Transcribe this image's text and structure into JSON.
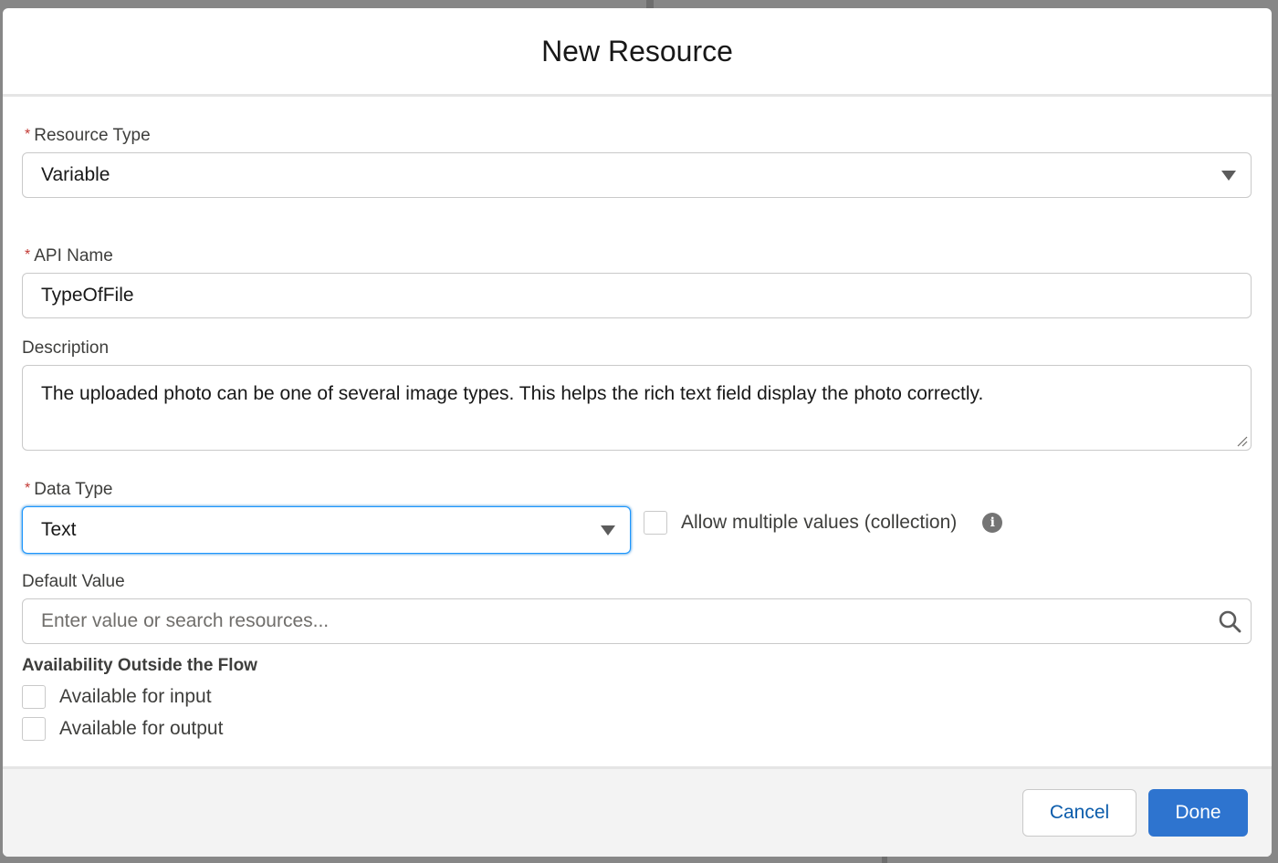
{
  "dialog": {
    "title": "New Resource"
  },
  "fields": {
    "resource_type": {
      "label": "Resource Type",
      "required": "*",
      "value": "Variable"
    },
    "api_name": {
      "label": "API Name",
      "required": "*",
      "value": "TypeOfFile"
    },
    "description": {
      "label": "Description",
      "value": "The uploaded photo can be one of several image types. This helps the rich text field display the photo correctly."
    },
    "data_type": {
      "label": "Data Type",
      "required": "*",
      "value": "Text"
    },
    "allow_multiple": {
      "label": "Allow multiple values (collection)",
      "checked": false,
      "info_icon": "info-icon"
    },
    "default_value": {
      "label": "Default Value",
      "placeholder": "Enter value or search resources...",
      "value": "",
      "icon": "search-icon"
    }
  },
  "availability": {
    "title": "Availability Outside the Flow",
    "options": [
      {
        "label": "Available for input",
        "checked": false
      },
      {
        "label": "Available for output",
        "checked": false
      }
    ]
  },
  "footer": {
    "cancel_label": "Cancel",
    "done_label": "Done"
  },
  "colors": {
    "brand": "#2e74cf",
    "required": "#c23934",
    "focus": "#1b96ff"
  }
}
